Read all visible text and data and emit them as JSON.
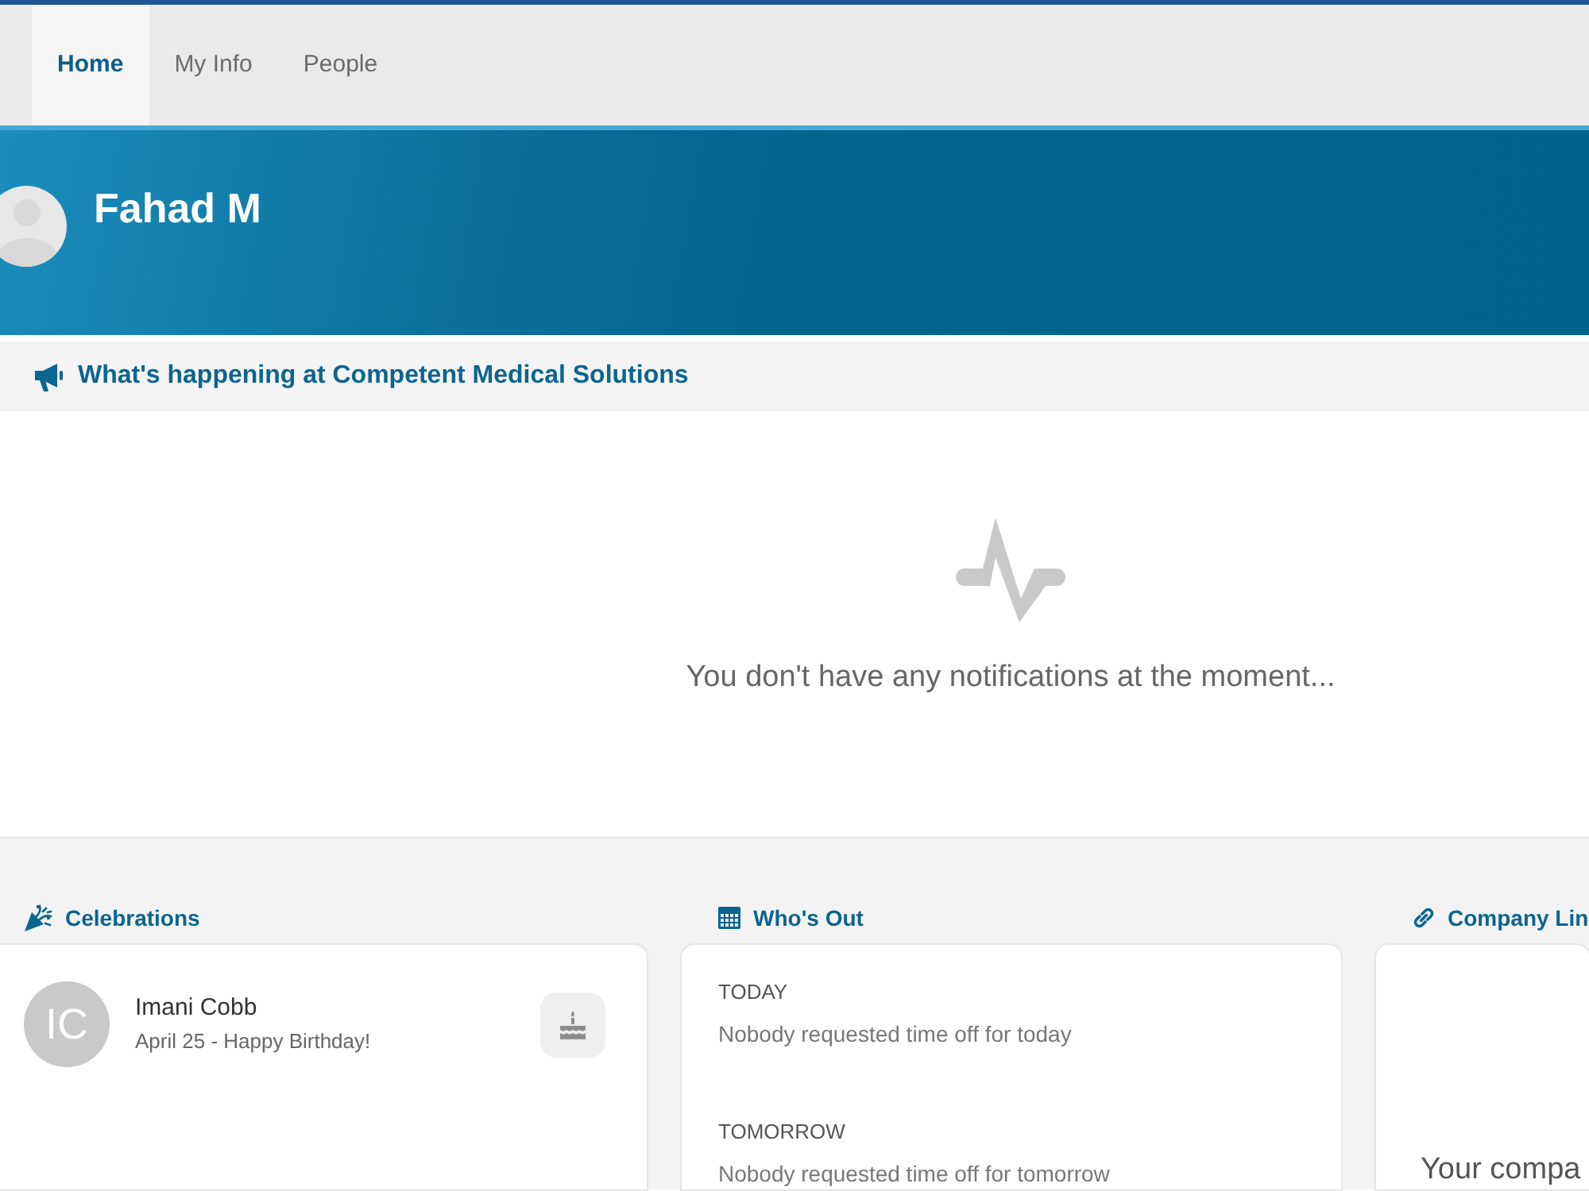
{
  "nav": {
    "tabs": [
      {
        "label": "Home",
        "selected": true
      },
      {
        "label": "My Info",
        "selected": false
      },
      {
        "label": "People",
        "selected": false
      }
    ]
  },
  "profile": {
    "name": "Fahad M"
  },
  "announcements": {
    "title": "What's happening at Competent Medical Solutions",
    "empty_message": "You don't have any notifications at the moment..."
  },
  "widgets": [
    {
      "kind": "celebrations",
      "title": "Celebrations",
      "items": [
        {
          "initials": "IC",
          "name": "Imani Cobb",
          "detail": "April 25 - Happy Birthday!"
        }
      ]
    },
    {
      "kind": "time_off",
      "title": "Who's Out",
      "groups": [
        {
          "heading": "TODAY",
          "message": "Nobody requested time off for today"
        },
        {
          "heading": "TOMORROW",
          "message": "Nobody requested time off for tomorrow"
        }
      ]
    },
    {
      "kind": "links",
      "title": "Company Lin",
      "message": "Your compa"
    }
  ]
}
